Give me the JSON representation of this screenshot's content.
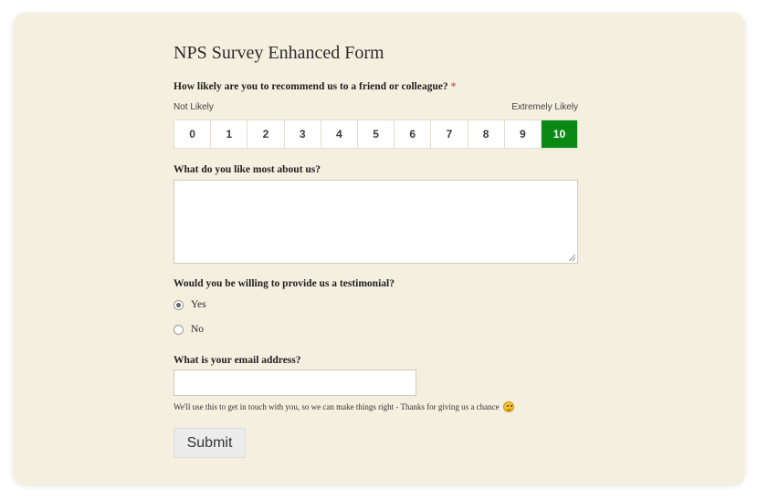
{
  "form": {
    "title": "NPS Survey Enhanced Form",
    "nps": {
      "question": "How likely are you to recommend us to a friend or colleague?",
      "required_mark": "*",
      "low_label": "Not Likely",
      "high_label": "Extremely Likely",
      "options": [
        "0",
        "1",
        "2",
        "3",
        "4",
        "5",
        "6",
        "7",
        "8",
        "9",
        "10"
      ],
      "selected": "10",
      "selected_color": "#0a8a14"
    },
    "like_most": {
      "question": "What do you like most about us?",
      "value": ""
    },
    "testimonial": {
      "question": "Would you be willing to provide us a testimonial?",
      "options": [
        {
          "label": "Yes",
          "checked": true
        },
        {
          "label": "No",
          "checked": false
        }
      ]
    },
    "email": {
      "question": "What is your email address?",
      "value": "",
      "hint": "We'll use this to get in touch with you, so we can make things right - Thanks for giving us a chance",
      "hint_icon": "smiley-icon"
    },
    "submit_label": "Submit"
  }
}
